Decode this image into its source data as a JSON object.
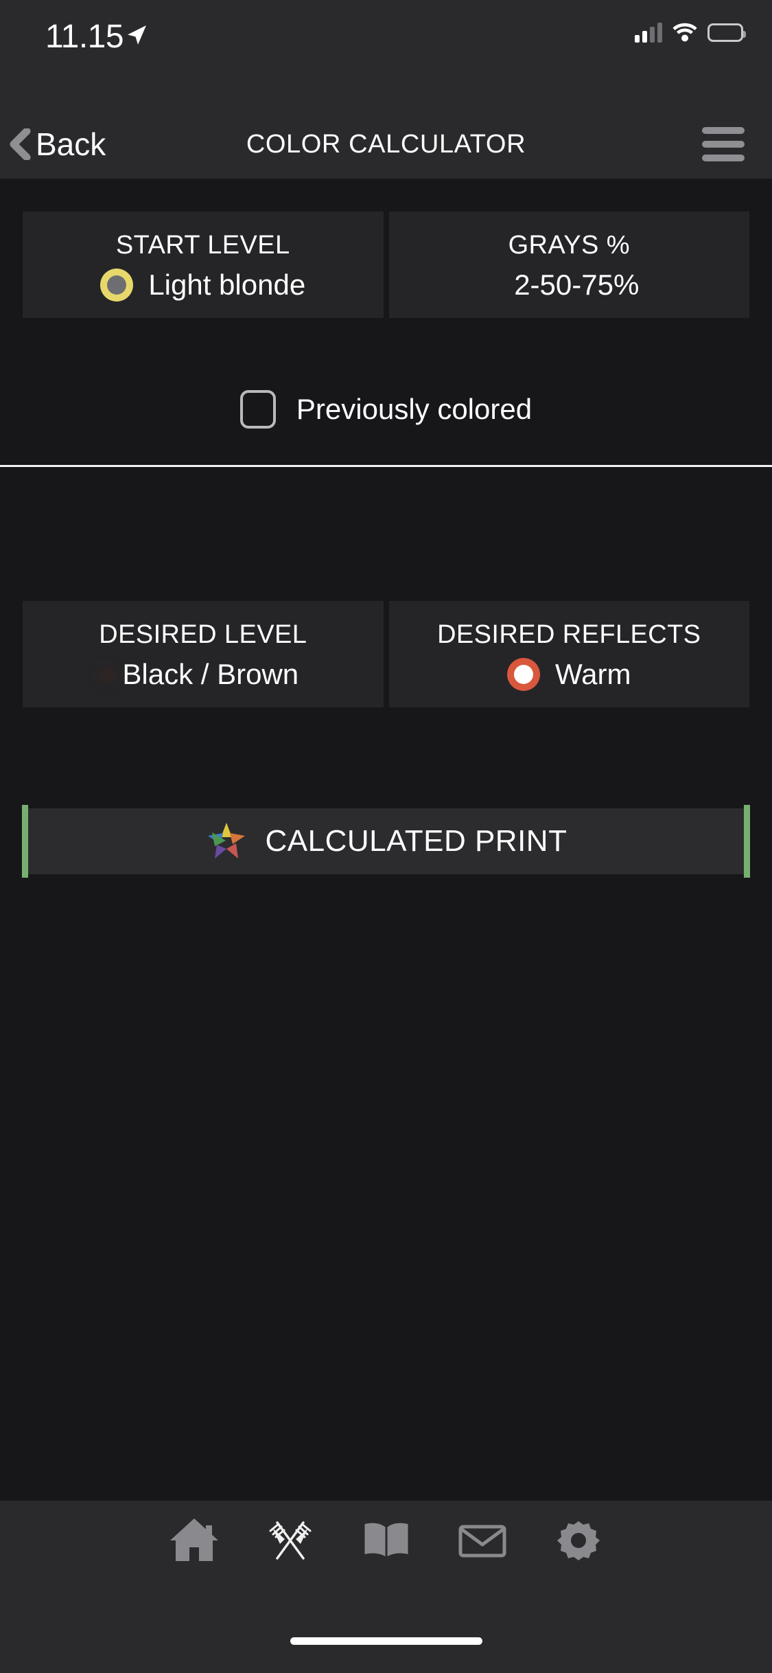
{
  "status_bar": {
    "time": "11.15",
    "location_icon": "location-arrow-icon",
    "cellular_icon": "cellular-signal-icon",
    "cellular_bars_filled": 2,
    "cellular_bars_total": 4,
    "wifi_icon": "wifi-icon",
    "battery_icon": "battery-icon"
  },
  "nav_bar": {
    "back_label": "Back",
    "back_icon": "chevron-left-icon",
    "title": "COLOR CALCULATOR",
    "menu_icon": "hamburger-menu-icon"
  },
  "start_section": {
    "cards": [
      {
        "title": "START LEVEL",
        "value": "Light blonde",
        "swatch_type": "ring",
        "swatch_ring_color": "#e7d86b",
        "swatch_inner_color": "#6e6e72"
      },
      {
        "title": "GRAYS %",
        "value": "2-50-75%",
        "swatch_type": "solid",
        "swatch_color": "#ffffff"
      }
    ],
    "checkbox": {
      "label": "Previously colored",
      "checked": false
    }
  },
  "desired_section": {
    "cards": [
      {
        "title": "DESIRED LEVEL",
        "value": "Black / Brown",
        "swatch_type": "solid",
        "swatch_color": "#a3a3a3"
      },
      {
        "title": "DESIRED REFLECTS",
        "value": "Warm",
        "swatch_type": "ring",
        "swatch_ring_color": "#d9573d",
        "swatch_inner_color": "#ffffff"
      }
    ]
  },
  "calculate": {
    "label": "CALCULATED PRINT",
    "icon": "color-star-icon",
    "accent_color": "#76b06e"
  },
  "tab_bar": {
    "items": [
      {
        "icon": "home-icon",
        "active": false
      },
      {
        "icon": "crossed-combs-icon",
        "active": true
      },
      {
        "icon": "book-icon",
        "active": false
      },
      {
        "icon": "envelope-icon",
        "active": false
      },
      {
        "icon": "gear-icon",
        "active": false
      }
    ]
  },
  "colors": {
    "background": "#17171a",
    "card": "#252528",
    "bar": "#2a2a2d",
    "accent_green": "#76b06e",
    "accent_orange": "#d9573d",
    "accent_yellow": "#e7d86b"
  }
}
